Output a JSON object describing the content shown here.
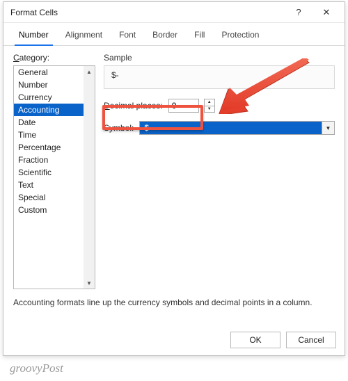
{
  "dialog": {
    "title": "Format Cells",
    "help_glyph": "?",
    "close_glyph": "✕"
  },
  "tabs": [
    {
      "label": "Number",
      "active": true
    },
    {
      "label": "Alignment",
      "active": false
    },
    {
      "label": "Font",
      "active": false
    },
    {
      "label": "Border",
      "active": false
    },
    {
      "label": "Fill",
      "active": false
    },
    {
      "label": "Protection",
      "active": false
    }
  ],
  "category": {
    "label_prefix": "C",
    "label_rest": "ategory:",
    "items": [
      "General",
      "Number",
      "Currency",
      "Accounting",
      "Date",
      "Time",
      "Percentage",
      "Fraction",
      "Scientific",
      "Text",
      "Special",
      "Custom"
    ],
    "selected": "Accounting"
  },
  "sample": {
    "label": "Sample",
    "value": "$-"
  },
  "decimal": {
    "label_plain": "ecimal places:",
    "label_ul": "D",
    "value": "0"
  },
  "symbol": {
    "label_plain": "ymbol:",
    "label_ul": "S",
    "value": "$"
  },
  "description": "Accounting formats line up the currency symbols and decimal points in a column.",
  "buttons": {
    "ok": "OK",
    "cancel": "Cancel"
  },
  "watermark": "groovyPost"
}
